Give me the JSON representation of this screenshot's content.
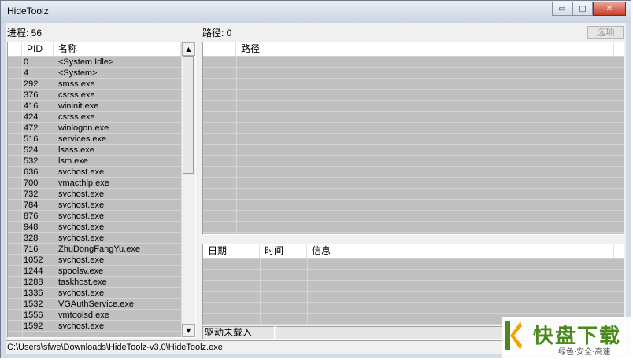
{
  "window": {
    "title": "HideToolz",
    "minimize": "▭",
    "maximize": "▢",
    "close": "✕"
  },
  "process": {
    "label": "进程: 56",
    "columns": [
      "",
      "PID",
      "名称"
    ],
    "rows": [
      {
        "pid": "0",
        "name": "<System Idle>"
      },
      {
        "pid": "4",
        "name": "<System>"
      },
      {
        "pid": "292",
        "name": "smss.exe"
      },
      {
        "pid": "376",
        "name": "csrss.exe"
      },
      {
        "pid": "416",
        "name": "wininit.exe"
      },
      {
        "pid": "424",
        "name": "csrss.exe"
      },
      {
        "pid": "472",
        "name": "winlogon.exe"
      },
      {
        "pid": "516",
        "name": "services.exe"
      },
      {
        "pid": "524",
        "name": "lsass.exe"
      },
      {
        "pid": "532",
        "name": "lsm.exe"
      },
      {
        "pid": "636",
        "name": "svchost.exe"
      },
      {
        "pid": "700",
        "name": "vmacthlp.exe"
      },
      {
        "pid": "732",
        "name": "svchost.exe"
      },
      {
        "pid": "784",
        "name": "svchost.exe"
      },
      {
        "pid": "876",
        "name": "svchost.exe"
      },
      {
        "pid": "948",
        "name": "svchost.exe"
      },
      {
        "pid": "328",
        "name": "svchost.exe"
      },
      {
        "pid": "716",
        "name": "ZhuDongFangYu.exe"
      },
      {
        "pid": "1052",
        "name": "svchost.exe"
      },
      {
        "pid": "1244",
        "name": "spoolsv.exe"
      },
      {
        "pid": "1288",
        "name": "taskhost.exe"
      },
      {
        "pid": "1336",
        "name": "svchost.exe"
      },
      {
        "pid": "1532",
        "name": "VGAuthService.exe"
      },
      {
        "pid": "1556",
        "name": "vmtoolsd.exe"
      },
      {
        "pid": "1592",
        "name": "svchost.exe"
      }
    ]
  },
  "path": {
    "label": "路径: 0",
    "options_button": "选项",
    "columns": [
      "",
      "路径"
    ]
  },
  "log": {
    "columns": [
      "日期",
      "时间",
      "信息"
    ]
  },
  "status": {
    "driver": "驱动未载入"
  },
  "filepath": "C:\\Users\\sfwe\\Downloads\\HideToolz-v3.0\\HideToolz.exe",
  "watermark": {
    "brand": "快盘下载",
    "slogan": "绿色·安全·高速"
  }
}
